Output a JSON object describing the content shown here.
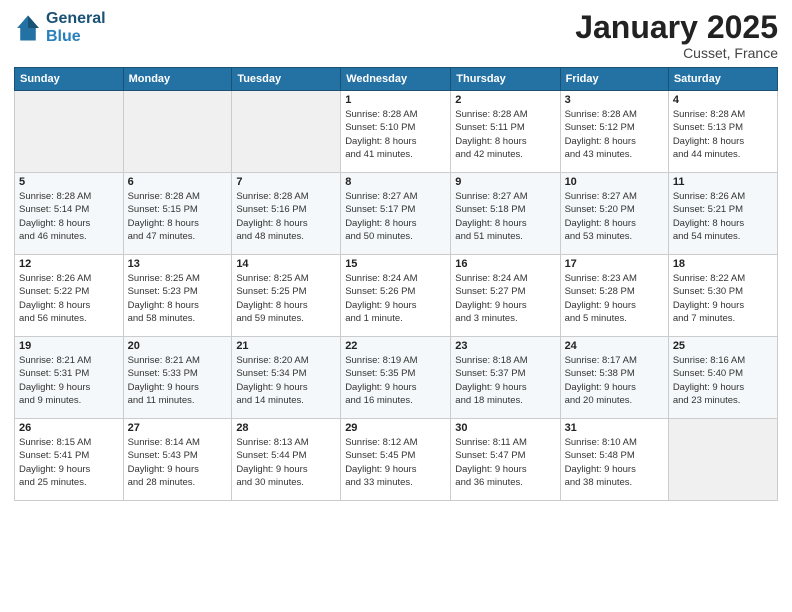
{
  "header": {
    "logo_line1": "General",
    "logo_line2": "Blue",
    "month": "January 2025",
    "location": "Cusset, France"
  },
  "weekdays": [
    "Sunday",
    "Monday",
    "Tuesday",
    "Wednesday",
    "Thursday",
    "Friday",
    "Saturday"
  ],
  "weeks": [
    [
      {
        "day": "",
        "info": ""
      },
      {
        "day": "",
        "info": ""
      },
      {
        "day": "",
        "info": ""
      },
      {
        "day": "1",
        "info": "Sunrise: 8:28 AM\nSunset: 5:10 PM\nDaylight: 8 hours\nand 41 minutes."
      },
      {
        "day": "2",
        "info": "Sunrise: 8:28 AM\nSunset: 5:11 PM\nDaylight: 8 hours\nand 42 minutes."
      },
      {
        "day": "3",
        "info": "Sunrise: 8:28 AM\nSunset: 5:12 PM\nDaylight: 8 hours\nand 43 minutes."
      },
      {
        "day": "4",
        "info": "Sunrise: 8:28 AM\nSunset: 5:13 PM\nDaylight: 8 hours\nand 44 minutes."
      }
    ],
    [
      {
        "day": "5",
        "info": "Sunrise: 8:28 AM\nSunset: 5:14 PM\nDaylight: 8 hours\nand 46 minutes."
      },
      {
        "day": "6",
        "info": "Sunrise: 8:28 AM\nSunset: 5:15 PM\nDaylight: 8 hours\nand 47 minutes."
      },
      {
        "day": "7",
        "info": "Sunrise: 8:28 AM\nSunset: 5:16 PM\nDaylight: 8 hours\nand 48 minutes."
      },
      {
        "day": "8",
        "info": "Sunrise: 8:27 AM\nSunset: 5:17 PM\nDaylight: 8 hours\nand 50 minutes."
      },
      {
        "day": "9",
        "info": "Sunrise: 8:27 AM\nSunset: 5:18 PM\nDaylight: 8 hours\nand 51 minutes."
      },
      {
        "day": "10",
        "info": "Sunrise: 8:27 AM\nSunset: 5:20 PM\nDaylight: 8 hours\nand 53 minutes."
      },
      {
        "day": "11",
        "info": "Sunrise: 8:26 AM\nSunset: 5:21 PM\nDaylight: 8 hours\nand 54 minutes."
      }
    ],
    [
      {
        "day": "12",
        "info": "Sunrise: 8:26 AM\nSunset: 5:22 PM\nDaylight: 8 hours\nand 56 minutes."
      },
      {
        "day": "13",
        "info": "Sunrise: 8:25 AM\nSunset: 5:23 PM\nDaylight: 8 hours\nand 58 minutes."
      },
      {
        "day": "14",
        "info": "Sunrise: 8:25 AM\nSunset: 5:25 PM\nDaylight: 8 hours\nand 59 minutes."
      },
      {
        "day": "15",
        "info": "Sunrise: 8:24 AM\nSunset: 5:26 PM\nDaylight: 9 hours\nand 1 minute."
      },
      {
        "day": "16",
        "info": "Sunrise: 8:24 AM\nSunset: 5:27 PM\nDaylight: 9 hours\nand 3 minutes."
      },
      {
        "day": "17",
        "info": "Sunrise: 8:23 AM\nSunset: 5:28 PM\nDaylight: 9 hours\nand 5 minutes."
      },
      {
        "day": "18",
        "info": "Sunrise: 8:22 AM\nSunset: 5:30 PM\nDaylight: 9 hours\nand 7 minutes."
      }
    ],
    [
      {
        "day": "19",
        "info": "Sunrise: 8:21 AM\nSunset: 5:31 PM\nDaylight: 9 hours\nand 9 minutes."
      },
      {
        "day": "20",
        "info": "Sunrise: 8:21 AM\nSunset: 5:33 PM\nDaylight: 9 hours\nand 11 minutes."
      },
      {
        "day": "21",
        "info": "Sunrise: 8:20 AM\nSunset: 5:34 PM\nDaylight: 9 hours\nand 14 minutes."
      },
      {
        "day": "22",
        "info": "Sunrise: 8:19 AM\nSunset: 5:35 PM\nDaylight: 9 hours\nand 16 minutes."
      },
      {
        "day": "23",
        "info": "Sunrise: 8:18 AM\nSunset: 5:37 PM\nDaylight: 9 hours\nand 18 minutes."
      },
      {
        "day": "24",
        "info": "Sunrise: 8:17 AM\nSunset: 5:38 PM\nDaylight: 9 hours\nand 20 minutes."
      },
      {
        "day": "25",
        "info": "Sunrise: 8:16 AM\nSunset: 5:40 PM\nDaylight: 9 hours\nand 23 minutes."
      }
    ],
    [
      {
        "day": "26",
        "info": "Sunrise: 8:15 AM\nSunset: 5:41 PM\nDaylight: 9 hours\nand 25 minutes."
      },
      {
        "day": "27",
        "info": "Sunrise: 8:14 AM\nSunset: 5:43 PM\nDaylight: 9 hours\nand 28 minutes."
      },
      {
        "day": "28",
        "info": "Sunrise: 8:13 AM\nSunset: 5:44 PM\nDaylight: 9 hours\nand 30 minutes."
      },
      {
        "day": "29",
        "info": "Sunrise: 8:12 AM\nSunset: 5:45 PM\nDaylight: 9 hours\nand 33 minutes."
      },
      {
        "day": "30",
        "info": "Sunrise: 8:11 AM\nSunset: 5:47 PM\nDaylight: 9 hours\nand 36 minutes."
      },
      {
        "day": "31",
        "info": "Sunrise: 8:10 AM\nSunset: 5:48 PM\nDaylight: 9 hours\nand 38 minutes."
      },
      {
        "day": "",
        "info": ""
      }
    ]
  ]
}
